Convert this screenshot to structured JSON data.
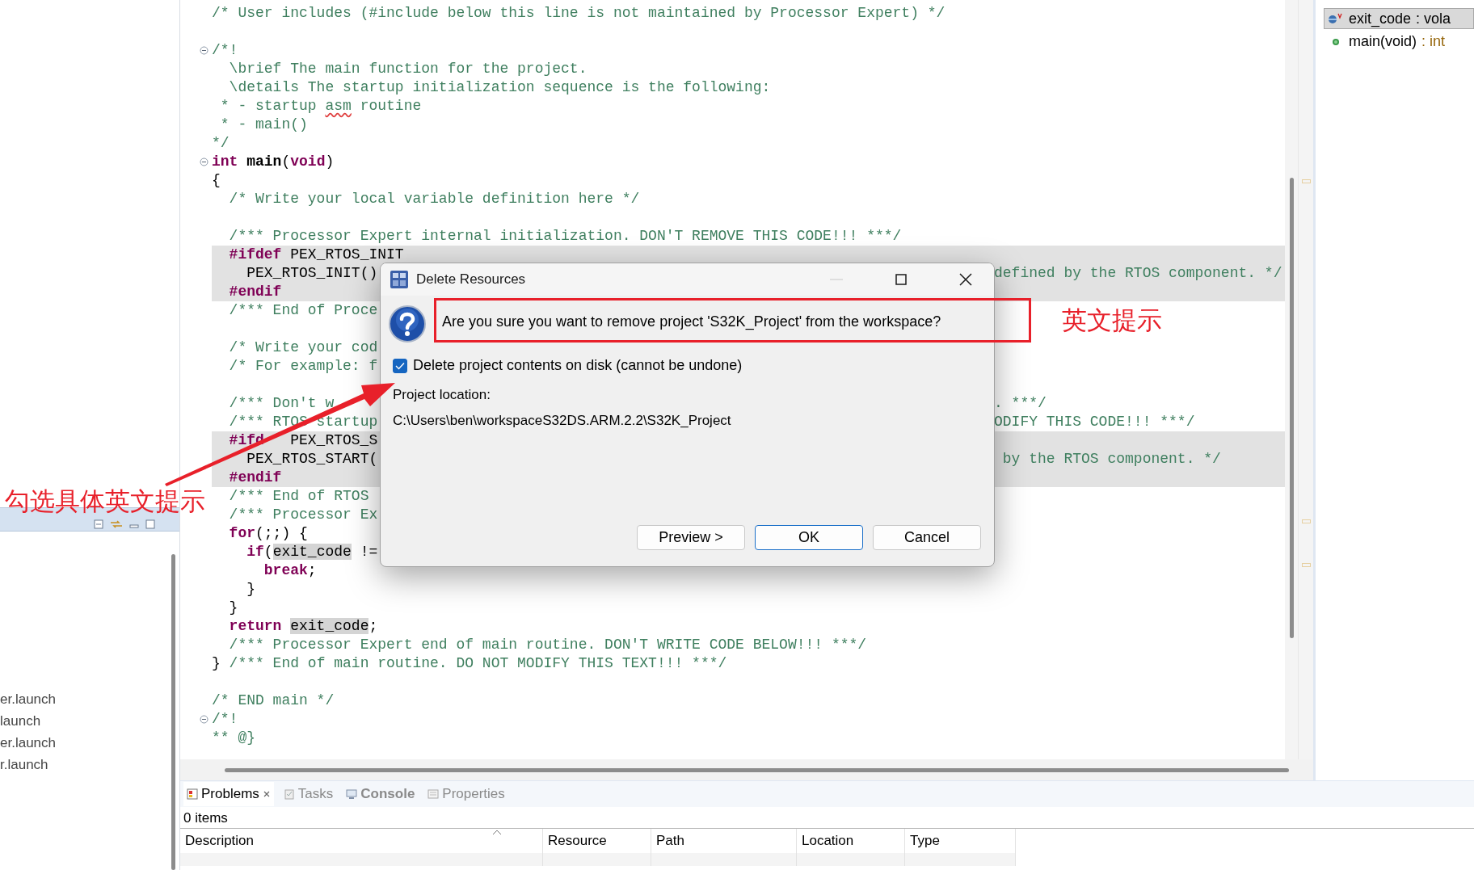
{
  "left_panel": {
    "items": [
      {
        "label": "er.launch"
      },
      {
        "label": "launch"
      },
      {
        "label": "er.launch"
      },
      {
        "label": "r.launch"
      }
    ]
  },
  "editor": {
    "lines": [
      {
        "kind": "code",
        "fold": false,
        "inactive": false,
        "tokens": [
          {
            "kind": "comment",
            "text": "/* User includes (#include below this line is not maintained by Processor Expert) */"
          }
        ]
      },
      {
        "kind": "blank"
      },
      {
        "kind": "code",
        "fold": true,
        "inactive": false,
        "tokens": [
          {
            "kind": "comment",
            "text": "/*!"
          }
        ]
      },
      {
        "kind": "code",
        "fold": false,
        "inactive": false,
        "tokens": [
          {
            "kind": "comment",
            "text": "  \\brief The main function for the project."
          }
        ]
      },
      {
        "kind": "code",
        "fold": false,
        "inactive": false,
        "tokens": [
          {
            "kind": "comment",
            "text": "  \\details The startup initialization sequence is the following:"
          }
        ]
      },
      {
        "kind": "code",
        "fold": false,
        "inactive": false,
        "tokens": [
          {
            "kind": "comment",
            "text": " * - startup "
          },
          {
            "kind": "misspelled",
            "text": "asm"
          },
          {
            "kind": "comment",
            "text": " routine"
          }
        ]
      },
      {
        "kind": "code",
        "fold": false,
        "inactive": false,
        "tokens": [
          {
            "kind": "comment",
            "text": " * - main()"
          }
        ]
      },
      {
        "kind": "code",
        "fold": false,
        "inactive": false,
        "tokens": [
          {
            "kind": "comment",
            "text": "*/"
          }
        ]
      },
      {
        "kind": "code",
        "fold": true,
        "inactive": false,
        "tokens": [
          {
            "kind": "keyword",
            "text": "int "
          },
          {
            "kind": "function",
            "text": "main"
          },
          {
            "kind": "plain",
            "text": "("
          },
          {
            "kind": "keyword",
            "text": "void"
          },
          {
            "kind": "plain",
            "text": ")"
          }
        ]
      },
      {
        "kind": "code",
        "fold": false,
        "inactive": false,
        "tokens": [
          {
            "kind": "plain",
            "text": "{"
          }
        ]
      },
      {
        "kind": "code",
        "fold": false,
        "inactive": false,
        "tokens": [
          {
            "kind": "comment",
            "text": "  /* Write your local variable definition here */"
          }
        ]
      },
      {
        "kind": "blank"
      },
      {
        "kind": "code",
        "fold": false,
        "inactive": false,
        "tokens": [
          {
            "kind": "comment",
            "text": "  /*** Processor Expert internal initialization. DON'T REMOVE THIS CODE!!! ***/"
          }
        ]
      },
      {
        "kind": "code",
        "fold": false,
        "inactive": true,
        "tokens": [
          {
            "kind": "directive",
            "text": "  #ifdef"
          },
          {
            "kind": "plain",
            "text": " PEX_RTOS_INIT"
          }
        ]
      },
      {
        "kind": "code",
        "fold": false,
        "inactive": true,
        "tokens": [
          {
            "kind": "plain",
            "text": "    PEX_RTOS_INIT()"
          }
        ],
        "right_part": [
          {
            "kind": "comment",
            "text": "defined by the RTOS component. */"
          }
        ]
      },
      {
        "kind": "code",
        "fold": false,
        "inactive": true,
        "tokens": [
          {
            "kind": "directive",
            "text": "  #endif"
          }
        ]
      },
      {
        "kind": "code",
        "fold": false,
        "inactive": false,
        "tokens": [
          {
            "kind": "comment",
            "text": "  /*** End of Proce"
          }
        ]
      },
      {
        "kind": "blank"
      },
      {
        "kind": "code",
        "fold": false,
        "inactive": false,
        "tokens": [
          {
            "kind": "comment",
            "text": "  /* Write your cod"
          }
        ]
      },
      {
        "kind": "code",
        "fold": false,
        "inactive": false,
        "tokens": [
          {
            "kind": "comment",
            "text": "  /* For example: f"
          }
        ]
      },
      {
        "kind": "blank"
      },
      {
        "kind": "code",
        "fold": false,
        "inactive": false,
        "tokens": [
          {
            "kind": "comment",
            "text": "  /*** Don't w"
          }
        ],
        "right_part": [
          {
            "kind": "comment",
            "text": ". ***/"
          }
        ]
      },
      {
        "kind": "code",
        "fold": false,
        "inactive": false,
        "tokens": [
          {
            "kind": "comment",
            "text": "  /*** RTOS startup"
          }
        ],
        "right_part": [
          {
            "kind": "comment",
            "text": "ODIFY THIS CODE!!! ***/"
          }
        ]
      },
      {
        "kind": "code",
        "fold": false,
        "inactive": true,
        "tokens": [
          {
            "kind": "directive",
            "text": "  #ifd"
          },
          {
            "kind": "resumed",
            "text": "PEX_RTOS_S"
          }
        ]
      },
      {
        "kind": "code",
        "fold": false,
        "inactive": true,
        "tokens": [
          {
            "kind": "plain",
            "text": "    PEX_RTOS_START("
          }
        ],
        "right_part": [
          {
            "kind": "comment",
            "text": " by the RTOS component. */"
          }
        ]
      },
      {
        "kind": "code",
        "fold": false,
        "inactive": true,
        "tokens": [
          {
            "kind": "directive",
            "text": "  #endif"
          }
        ]
      },
      {
        "kind": "code",
        "fold": false,
        "inactive": false,
        "tokens": [
          {
            "kind": "comment",
            "text": "  /*** End of RTOS"
          }
        ]
      },
      {
        "kind": "code",
        "fold": false,
        "inactive": false,
        "tokens": [
          {
            "kind": "comment",
            "text": "  /*** Processor Ex"
          }
        ]
      },
      {
        "kind": "code",
        "fold": false,
        "inactive": false,
        "tokens": [
          {
            "kind": "keyword",
            "text": "  for"
          },
          {
            "kind": "plain",
            "text": "(;;) {"
          }
        ]
      },
      {
        "kind": "code",
        "fold": false,
        "inactive": false,
        "tokens": [
          {
            "kind": "keyword",
            "text": "    if"
          },
          {
            "kind": "plain",
            "text": "("
          },
          {
            "kind": "occurrence",
            "text": "exit_code"
          },
          {
            "kind": "plain",
            "text": " !="
          }
        ]
      },
      {
        "kind": "code",
        "fold": false,
        "inactive": false,
        "tokens": [
          {
            "kind": "keyword",
            "text": "      break"
          },
          {
            "kind": "plain",
            "text": ";"
          }
        ]
      },
      {
        "kind": "code",
        "fold": false,
        "inactive": false,
        "tokens": [
          {
            "kind": "plain",
            "text": "    }"
          }
        ]
      },
      {
        "kind": "code",
        "fold": false,
        "inactive": false,
        "tokens": [
          {
            "kind": "plain",
            "text": "  }"
          }
        ]
      },
      {
        "kind": "code",
        "fold": false,
        "inactive": false,
        "tokens": [
          {
            "kind": "keyword",
            "text": "  return "
          },
          {
            "kind": "occurrence",
            "text": "exit_code"
          },
          {
            "kind": "plain",
            "text": ";"
          }
        ]
      },
      {
        "kind": "code",
        "fold": false,
        "inactive": false,
        "tokens": [
          {
            "kind": "comment",
            "text": "  /*** Processor Expert end of main routine. DON'T WRITE CODE BELOW!!! ***/"
          }
        ]
      },
      {
        "kind": "code",
        "fold": false,
        "inactive": false,
        "tokens": [
          {
            "kind": "plain",
            "text": "} "
          },
          {
            "kind": "comment",
            "text": "/*** End of main routine. DO NOT MODIFY THIS TEXT!!! ***/"
          }
        ]
      },
      {
        "kind": "blank"
      },
      {
        "kind": "code",
        "fold": false,
        "inactive": false,
        "tokens": [
          {
            "kind": "comment",
            "text": "/* END main */"
          }
        ]
      },
      {
        "kind": "code",
        "fold": true,
        "inactive": false,
        "tokens": [
          {
            "kind": "comment",
            "text": "/*!"
          }
        ]
      },
      {
        "kind": "code",
        "fold": false,
        "inactive": false,
        "tokens": [
          {
            "kind": "comment",
            "text": "** @}"
          }
        ]
      }
    ]
  },
  "outline": {
    "items": [
      {
        "kind": "variable",
        "name": "exit_code",
        "detail": " : vola",
        "selected": true
      },
      {
        "kind": "function",
        "name": "main(void)",
        "detail": " : int",
        "selected": false
      }
    ]
  },
  "dialog": {
    "title": "Delete Resources",
    "controls": [
      {
        "kind": "minimize",
        "disabled": true
      },
      {
        "kind": "maximize",
        "disabled": false
      },
      {
        "kind": "close",
        "disabled": false
      }
    ],
    "message": "Are you sure you want to remove project 'S32K_Project' from the workspace?",
    "checkbox": {
      "label": "Delete project contents on disk (cannot be undone)",
      "checked": true
    },
    "location_label": "Project location:",
    "location": "C:\\Users\\ben\\workspaceS32DS.ARM.2.2\\S32K_Project",
    "buttons": [
      {
        "label": "Preview >",
        "default": false
      },
      {
        "label": "OK",
        "default": true
      },
      {
        "label": "Cancel",
        "default": false
      }
    ]
  },
  "problems": {
    "tabs": [
      {
        "kind": "problems",
        "label": "Problems",
        "selected": true,
        "emphasized": false
      },
      {
        "kind": "tasks",
        "label": "Tasks",
        "selected": false,
        "emphasized": false
      },
      {
        "kind": "console",
        "label": "Console",
        "selected": false,
        "emphasized": true
      },
      {
        "kind": "properties",
        "label": "Properties",
        "selected": false,
        "emphasized": false
      }
    ],
    "count": "0 items",
    "columns": [
      {
        "label": "Description",
        "sorted": true
      },
      {
        "label": "Resource",
        "sorted": false
      },
      {
        "label": "Path",
        "sorted": false
      },
      {
        "label": "Location",
        "sorted": false
      },
      {
        "label": "Type",
        "sorted": false
      }
    ]
  },
  "annotations": [
    {
      "kind": "box"
    },
    {
      "kind": "label",
      "text": "英文提示"
    },
    {
      "kind": "arrow"
    },
    {
      "kind": "label",
      "text": "勾选具体英文提示"
    }
  ]
}
